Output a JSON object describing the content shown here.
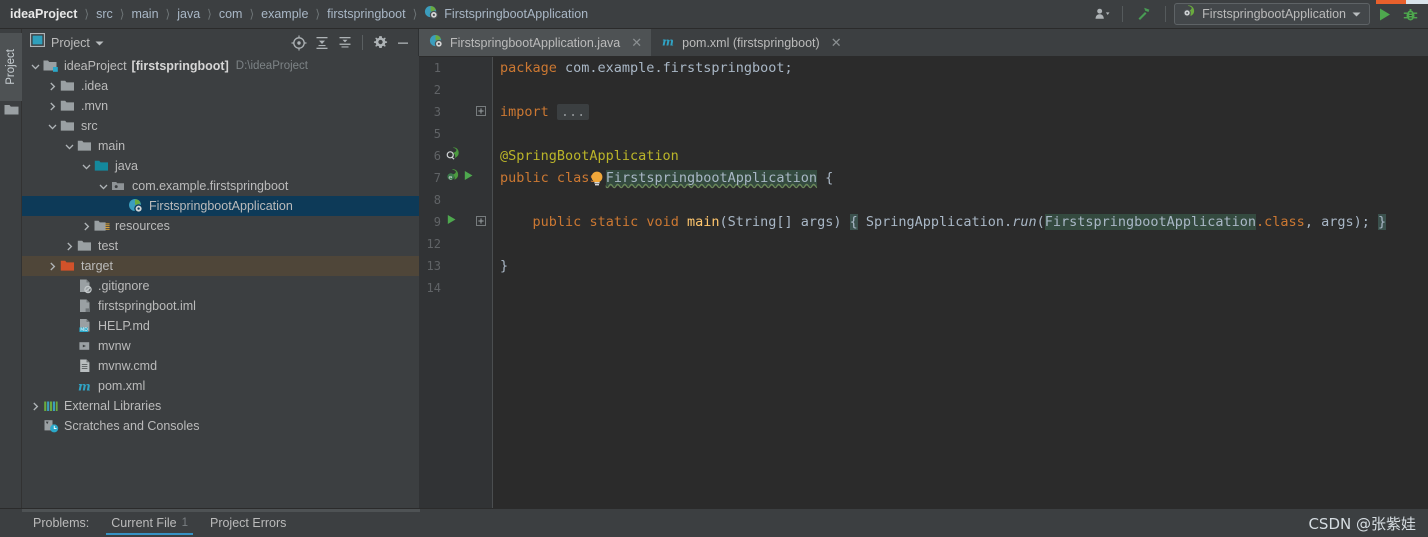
{
  "app": {
    "theme_bg": "#3c3f41",
    "editor_bg": "#2b2b2b",
    "accent": "#3592c4",
    "selection": "#0d3a58",
    "marked_row": "#4f4639"
  },
  "topbar": {
    "breadcrumb": [
      {
        "label": "ideaProject",
        "root": true
      },
      {
        "label": "src"
      },
      {
        "label": "main"
      },
      {
        "label": "java"
      },
      {
        "label": "com"
      },
      {
        "label": "example"
      },
      {
        "label": "firstspringboot"
      },
      {
        "label": "FirstspringbootApplication",
        "icon": "spring-class-icon"
      }
    ],
    "separator": "〉",
    "profile_icon": "user-profile-icon",
    "hammer_icon": "build-hammer-icon",
    "run_config": {
      "icon": "spring-boot-run-icon",
      "label": "FirstspringbootApplication",
      "dropdown_icon": "chevron-down-icon"
    },
    "run_icon": "run-triangle-icon",
    "debug_icon": "debug-bug-icon"
  },
  "left_strip": {
    "tab_label": "Project",
    "folder_icon": "folder-icon"
  },
  "project_panel": {
    "title": "Project",
    "title_icon": "project-view-icon",
    "dropdown_icon": "chevron-down-icon",
    "tools": [
      {
        "name": "locate-icon",
        "title": "Select Opened File"
      },
      {
        "name": "expand-all-icon",
        "title": "Expand All"
      },
      {
        "name": "collapse-all-icon",
        "title": "Collapse All"
      },
      {
        "name": "gear-icon",
        "title": "Settings"
      },
      {
        "name": "minimize-icon",
        "title": "Hide"
      }
    ],
    "tree": [
      {
        "indent": 0,
        "arrow": "down",
        "icon": "project-root-icon",
        "label": "ideaProject",
        "bold_label": "[firstspringboot]",
        "path": "D:\\ideaProject",
        "state": "normal"
      },
      {
        "indent": 1,
        "arrow": "right",
        "icon": "folder-icon",
        "label": ".idea",
        "state": "normal"
      },
      {
        "indent": 1,
        "arrow": "right",
        "icon": "folder-icon",
        "label": ".mvn",
        "state": "normal"
      },
      {
        "indent": 1,
        "arrow": "down",
        "icon": "folder-icon",
        "label": "src",
        "state": "normal"
      },
      {
        "indent": 2,
        "arrow": "down",
        "icon": "folder-icon",
        "label": "main",
        "state": "normal"
      },
      {
        "indent": 3,
        "arrow": "down",
        "icon": "source-folder-icon",
        "label": "java",
        "state": "normal"
      },
      {
        "indent": 4,
        "arrow": "down",
        "icon": "package-icon",
        "label": "com.example.firstspringboot",
        "state": "normal"
      },
      {
        "indent": 5,
        "arrow": "none",
        "icon": "spring-class-icon",
        "label": "FirstspringbootApplication",
        "state": "selected"
      },
      {
        "indent": 3,
        "arrow": "right",
        "icon": "resources-folder-icon",
        "label": "resources",
        "state": "normal"
      },
      {
        "indent": 2,
        "arrow": "right",
        "icon": "folder-icon",
        "label": "test",
        "state": "normal"
      },
      {
        "indent": 1,
        "arrow": "right",
        "icon": "excluded-folder-icon",
        "label": "target",
        "state": "marked"
      },
      {
        "indent": 2,
        "arrow": "none",
        "icon": "gitignore-file-icon",
        "label": ".gitignore",
        "state": "normal"
      },
      {
        "indent": 2,
        "arrow": "none",
        "icon": "iml-file-icon",
        "label": "firstspringboot.iml",
        "state": "normal"
      },
      {
        "indent": 2,
        "arrow": "none",
        "icon": "markdown-file-icon",
        "label": "HELP.md",
        "state": "normal"
      },
      {
        "indent": 2,
        "arrow": "none",
        "icon": "script-file-icon",
        "label": "mvnw",
        "state": "normal"
      },
      {
        "indent": 2,
        "arrow": "none",
        "icon": "cmd-file-icon",
        "label": "mvnw.cmd",
        "state": "normal"
      },
      {
        "indent": 2,
        "arrow": "none",
        "icon": "maven-pom-icon",
        "label": "pom.xml",
        "state": "normal"
      },
      {
        "indent": 0,
        "arrow": "right",
        "icon": "external-libraries-icon",
        "label": "External Libraries",
        "state": "normal"
      },
      {
        "indent": 0,
        "arrow": "none",
        "icon": "scratches-icon",
        "label": "Scratches and Consoles",
        "state": "normal"
      }
    ]
  },
  "editor": {
    "tabs": [
      {
        "label": "FirstspringbootApplication.java",
        "icon": "spring-class-icon",
        "active": true,
        "close_icon": "close-icon"
      },
      {
        "label": "pom.xml (firstspringboot)",
        "icon": "maven-pom-icon",
        "active": false,
        "close_icon": "close-icon"
      }
    ],
    "lines": [
      {
        "num": "1",
        "gutter_icons": [],
        "fold": false
      },
      {
        "num": "2",
        "gutter_icons": [],
        "fold": false
      },
      {
        "num": "3",
        "gutter_icons": [],
        "fold": "plus"
      },
      {
        "num": "5",
        "gutter_icons": [],
        "fold": false
      },
      {
        "num": "6",
        "gutter_icons": [
          "spring-bean-search-icon"
        ],
        "fold": false
      },
      {
        "num": "7",
        "gutter_icons": [
          "spring-bean-icon",
          "run-triangle-icon"
        ],
        "fold": false
      },
      {
        "num": "8",
        "gutter_icons": [],
        "fold": false
      },
      {
        "num": "9",
        "gutter_icons": [
          "run-triangle-icon"
        ],
        "fold": "plus"
      },
      {
        "num": "12",
        "gutter_icons": [],
        "fold": false
      },
      {
        "num": "13",
        "gutter_icons": [],
        "fold": false
      },
      {
        "num": "14",
        "gutter_icons": [],
        "fold": false
      }
    ],
    "code": {
      "l1_kw": "package",
      "l1_rest": " com.example.firstspringboot;",
      "l3_kw": "import",
      "l3_fold": "...",
      "l6_annotation": "@SpringBootApplication",
      "l7_kw1": "public",
      "l7_kw2": "class",
      "l7_name": "FirstspringbootApplication",
      "l7_brace": "{",
      "l9_kw1": "public",
      "l9_kw2": "static",
      "l9_kw3": "void",
      "l9_method": "main",
      "l9_params": "(String[] args)",
      "l9_open": "{",
      "l9_call_obj": "SpringApplication",
      "l9_call_dot": ".",
      "l9_call_run": "run",
      "l9_arg_open": "(",
      "l9_arg_cls": "FirstspringbootApplication",
      "l9_arg_class_kw": ".class",
      "l9_arg_rest": ", args);",
      "l9_close": "}",
      "l13_close": "}"
    },
    "intention_bulb": "intention-lightbulb-icon"
  },
  "bottom_bar": {
    "problems_label": "Problems:",
    "current_file_label": "Current File",
    "current_file_count": "1",
    "project_errors_label": "Project Errors",
    "watermark": "CSDN @张紫娃"
  }
}
